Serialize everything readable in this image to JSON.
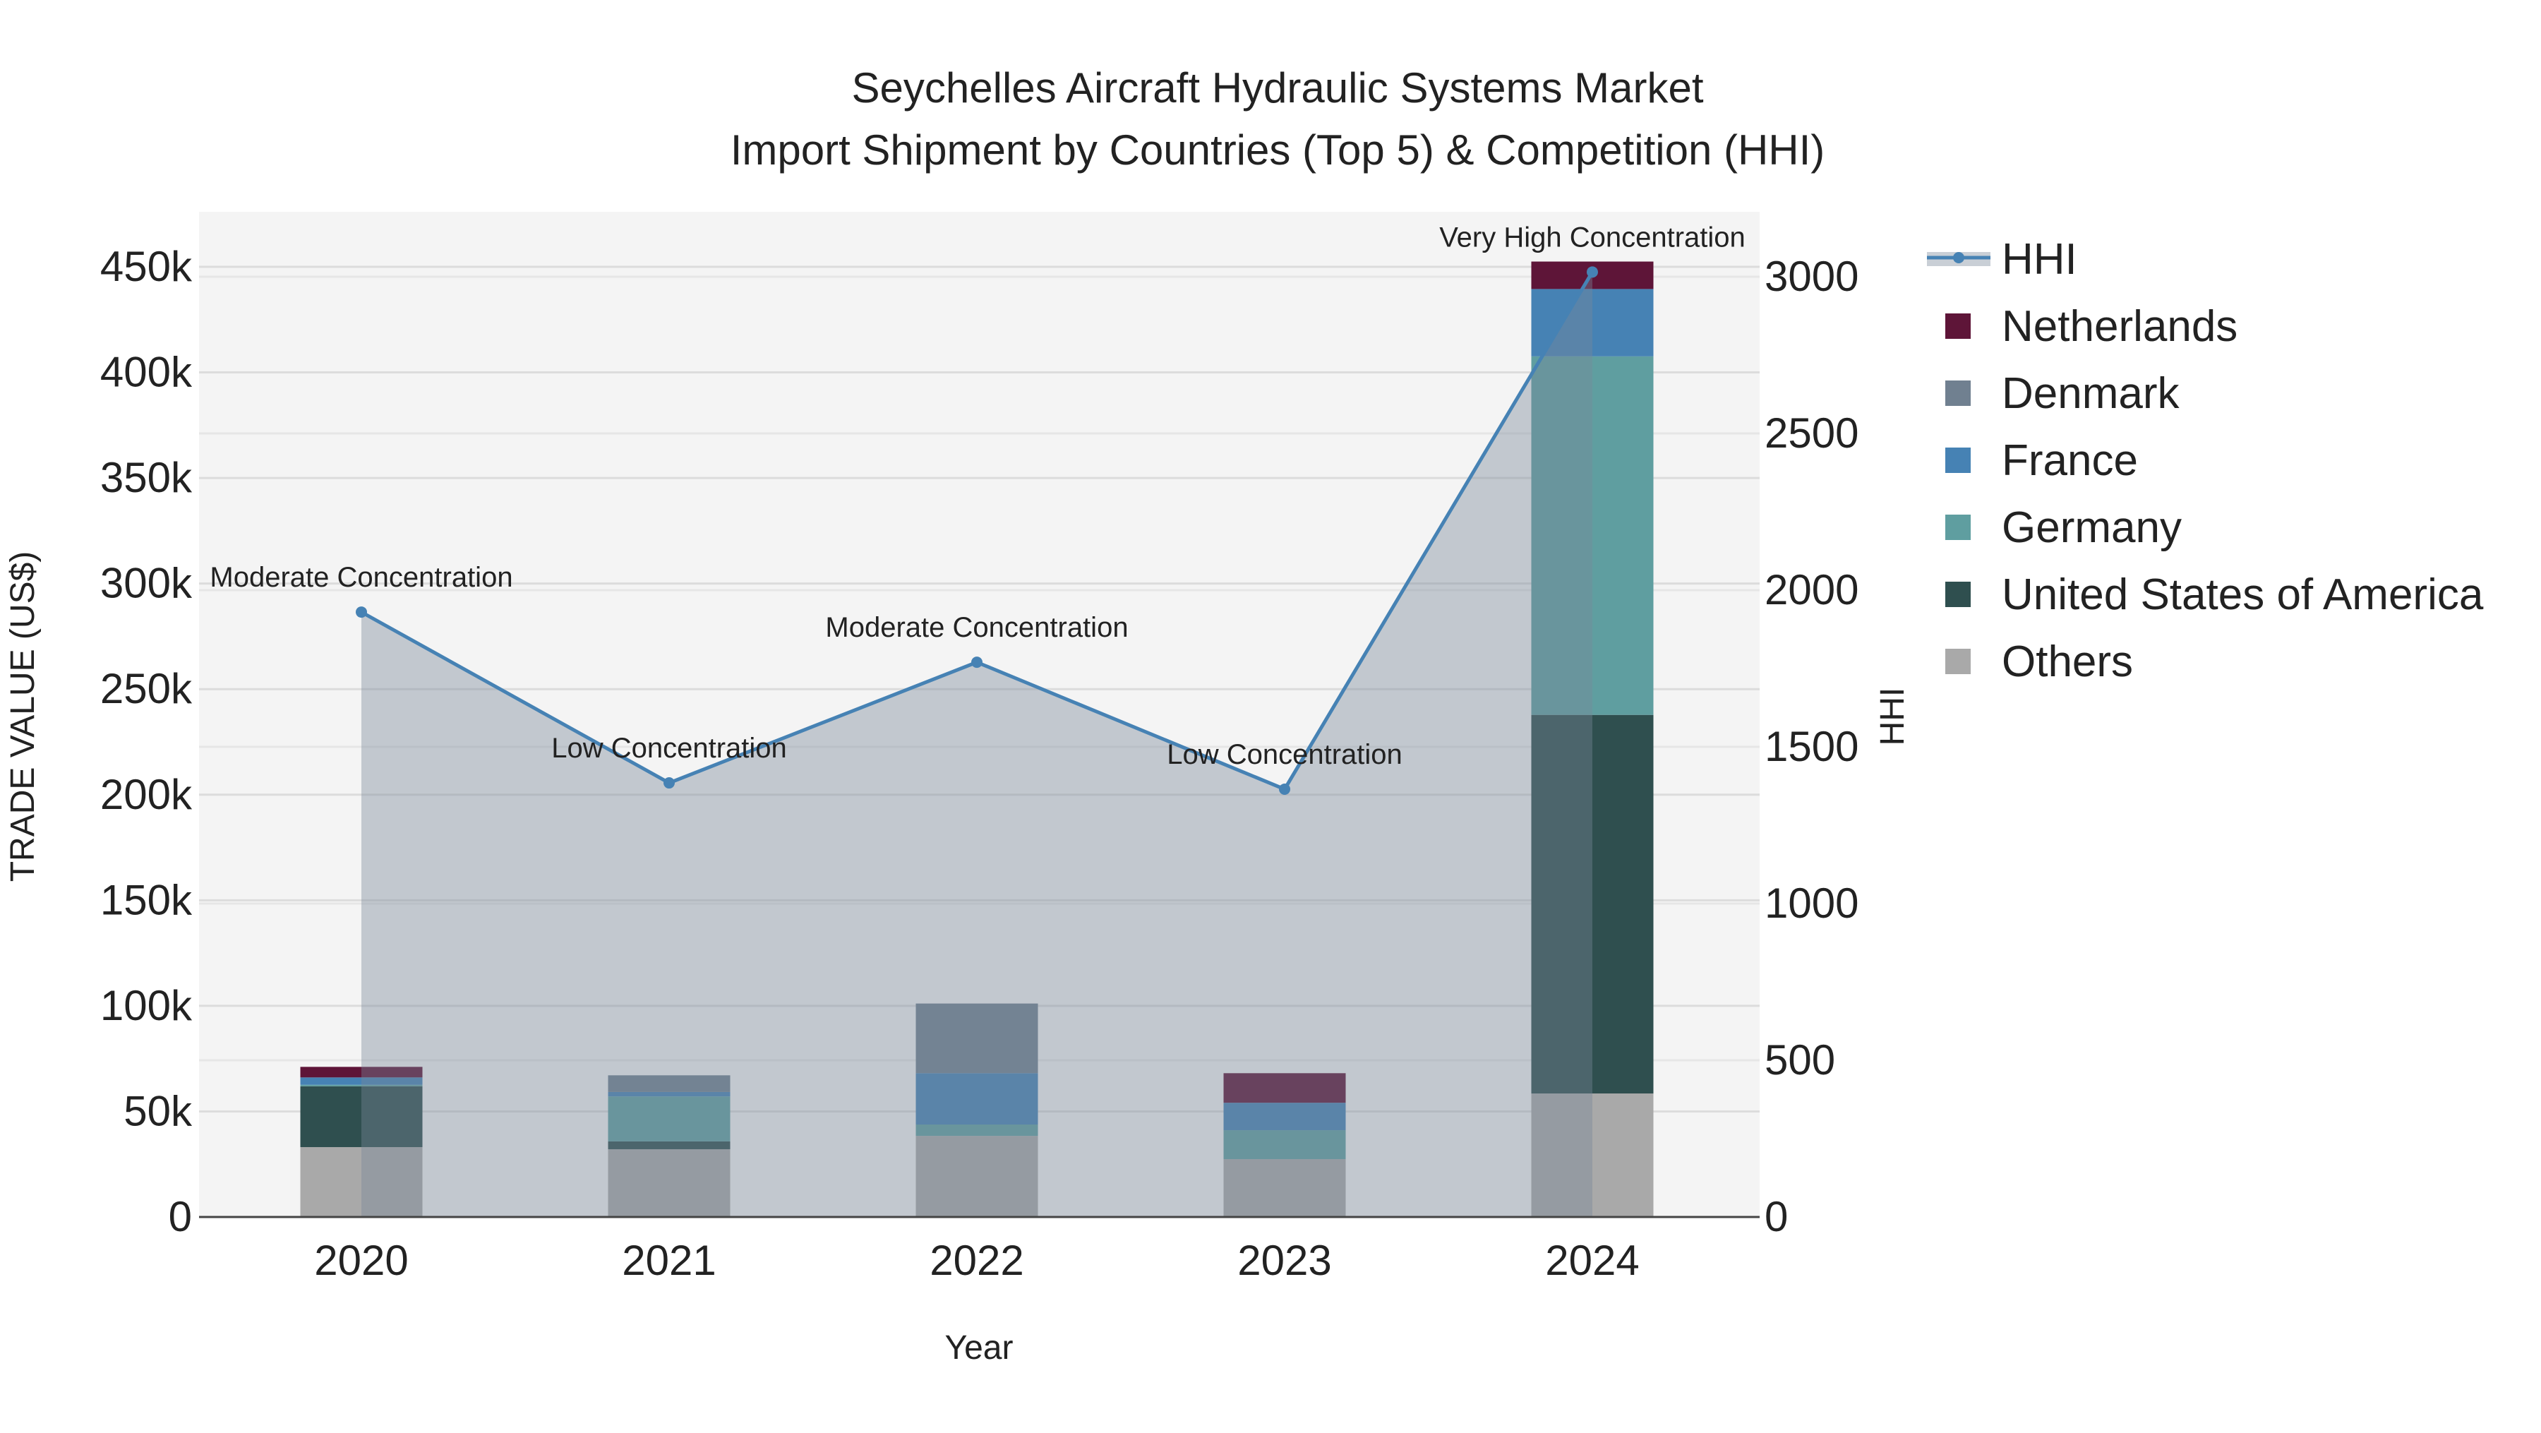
{
  "chart_data": {
    "type": "bar",
    "title": [
      "Seychelles Aircraft Hydraulic Systems Market",
      "Import Shipment by Countries (Top 5) & Competition (HHI)"
    ],
    "xlabel": "Year",
    "ylabel": "TRADE VALUE (US$)",
    "y2label": "HHI",
    "categories": [
      "2020",
      "2021",
      "2022",
      "2023",
      "2024"
    ],
    "ylim": [
      0,
      475000
    ],
    "y2lim": [
      0,
      3200
    ],
    "yticks": [
      0,
      50000,
      100000,
      150000,
      200000,
      250000,
      300000,
      350000,
      400000,
      450000
    ],
    "yticklabels": [
      "0",
      "50k",
      "100k",
      "150k",
      "200k",
      "250k",
      "300k",
      "350k",
      "400k",
      "450k"
    ],
    "y2ticks": [
      0,
      500,
      1000,
      1500,
      2000,
      2500,
      3000
    ],
    "y2ticklabels": [
      "0",
      "500",
      "1000",
      "1500",
      "2000",
      "2500",
      "3000"
    ],
    "legend_position": "right",
    "series": [
      {
        "name": "Others",
        "color": "#a9a9a9",
        "values": [
          33100,
          32100,
          38400,
          27400,
          58500
        ]
      },
      {
        "name": "United States of America",
        "color": "#2f4f4f",
        "values": [
          28800,
          3700,
          0,
          0,
          179300
        ]
      },
      {
        "name": "Germany",
        "color": "#5f9ea0",
        "values": [
          700,
          21300,
          5400,
          13700,
          169800
        ]
      },
      {
        "name": "France",
        "color": "#4682b4",
        "values": [
          3500,
          2100,
          24300,
          13000,
          31900
        ]
      },
      {
        "name": "Denmark",
        "color": "#708090",
        "values": [
          0,
          7900,
          33000,
          0,
          0
        ]
      },
      {
        "name": "Netherlands",
        "color": "#5e1538",
        "values": [
          5000,
          0,
          0,
          14000,
          13000
        ]
      }
    ],
    "hhi": {
      "name": "HHI",
      "color": "#4682b4",
      "values": [
        1930,
        1385,
        1770,
        1365,
        3015
      ],
      "annotations": [
        "Moderate Concentration",
        "Low Concentration",
        "Moderate Concentration",
        "Low Concentration",
        "Very High Concentration"
      ]
    },
    "legend_order": [
      "HHI",
      "Netherlands",
      "Denmark",
      "France",
      "Germany",
      "United States of America",
      "Others"
    ]
  }
}
